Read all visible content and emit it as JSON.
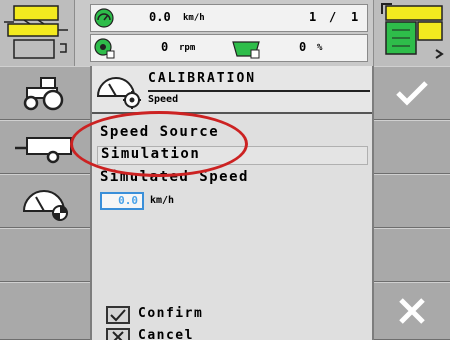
{
  "status": {
    "speed_value": "0.0",
    "speed_unit": "km/h",
    "counter_value": "1",
    "counter_sep": "/",
    "counter_total": "1",
    "rpm_value": "0",
    "rpm_unit": "rpm",
    "percent_value": "0",
    "percent_unit": "%"
  },
  "header": {
    "title": "CALIBRATION",
    "subtitle": "Speed"
  },
  "form": {
    "speed_source_label": "Speed Source",
    "speed_source_value": "Simulation",
    "simulated_speed_label": "Simulated Speed",
    "simulated_speed_value": "0.0",
    "simulated_speed_unit": "km/h"
  },
  "footer": {
    "confirm_label": "Confirm",
    "cancel_label": "Cancel"
  },
  "colors": {
    "highlight": "#cc2222",
    "input_border": "#3a8fd9",
    "icon_yellow": "#f3ea1f",
    "icon_green": "#2ebd4a"
  },
  "icons": {
    "left_column": [
      "tractor-icon",
      "trailer-icon",
      "speedometer-icon"
    ],
    "right_column": [
      "checkmark-icon",
      "close-icon"
    ]
  }
}
